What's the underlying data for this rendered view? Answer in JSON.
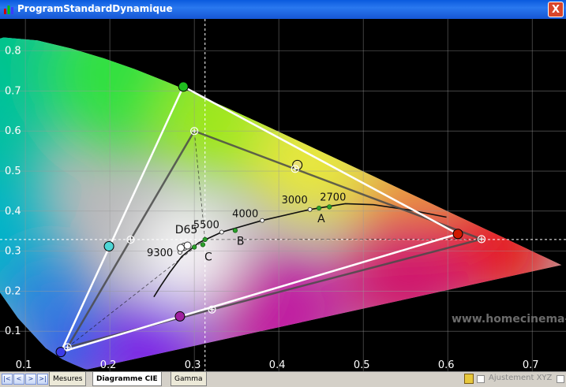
{
  "window": {
    "title": "ProgramStandardDynamique",
    "close_label": "X"
  },
  "tabs": [
    {
      "label": "Mesures",
      "active": false
    },
    {
      "label": "Diagramme CIE",
      "active": true
    },
    {
      "label": "Gamma",
      "active": false
    }
  ],
  "nav": {
    "first": "|<",
    "prev": "<",
    "next": ">",
    "last": ">|"
  },
  "statusbar": {
    "xyz_label": "Ajustement XYZ"
  },
  "watermark": "www.homecinema-",
  "colors": {
    "measured_red": "#d01a00",
    "measured_green": "#1fbe1f",
    "measured_blue": "#3c3ce8",
    "measured_cyan": "#4fd6d6",
    "measured_magenta": "#a020a0",
    "measured_yellow": "#e8e070",
    "gray_point": "#2ca02c",
    "target": "#ffffff"
  },
  "chart_data": {
    "type": "scatter",
    "xlim": [
      0.07,
      0.74
    ],
    "ylim": [
      0.0,
      0.88
    ],
    "xticks": [
      0.1,
      0.2,
      0.3,
      0.4,
      0.5,
      0.6,
      0.7
    ],
    "xtick_labels": [
      "0.1",
      "0.2",
      "0.3",
      "0.4",
      "0.5",
      "0.6",
      "0.7"
    ],
    "yticks": [
      0.1,
      0.2,
      0.3,
      0.4,
      0.5,
      0.6,
      0.7,
      0.8
    ],
    "ytick_labels": [
      "0.1",
      "0.2",
      "0.3",
      "0.4",
      "0.5",
      "0.6",
      "0.7",
      "0.8"
    ],
    "grid": true,
    "spectral_locus": [
      [
        0.1741,
        0.005
      ],
      [
        0.1733,
        0.0048
      ],
      [
        0.1726,
        0.0048
      ],
      [
        0.1714,
        0.0051
      ],
      [
        0.1689,
        0.0069
      ],
      [
        0.1644,
        0.0109
      ],
      [
        0.1566,
        0.0177
      ],
      [
        0.144,
        0.0297
      ],
      [
        0.1241,
        0.0578
      ],
      [
        0.0913,
        0.1327
      ],
      [
        0.0687,
        0.2007
      ],
      [
        0.0454,
        0.295
      ],
      [
        0.0235,
        0.4127
      ],
      [
        0.0082,
        0.5384
      ],
      [
        0.0039,
        0.6548
      ],
      [
        0.0139,
        0.7502
      ],
      [
        0.0389,
        0.812
      ],
      [
        0.0743,
        0.8338
      ],
      [
        0.1142,
        0.8262
      ],
      [
        0.1547,
        0.8059
      ],
      [
        0.1929,
        0.7816
      ],
      [
        0.2296,
        0.7543
      ],
      [
        0.2658,
        0.7243
      ],
      [
        0.3016,
        0.6923
      ],
      [
        0.3373,
        0.6589
      ],
      [
        0.3731,
        0.6245
      ],
      [
        0.4087,
        0.5896
      ],
      [
        0.4441,
        0.5547
      ],
      [
        0.4788,
        0.5202
      ],
      [
        0.5125,
        0.4866
      ],
      [
        0.5448,
        0.4544
      ],
      [
        0.5752,
        0.4242
      ],
      [
        0.6029,
        0.3965
      ],
      [
        0.627,
        0.3725
      ],
      [
        0.6482,
        0.3514
      ],
      [
        0.6658,
        0.334
      ],
      [
        0.6801,
        0.3197
      ],
      [
        0.6915,
        0.3083
      ],
      [
        0.7006,
        0.2993
      ],
      [
        0.7079,
        0.292
      ],
      [
        0.714,
        0.2859
      ],
      [
        0.7347,
        0.2653
      ]
    ],
    "target_gamut": [
      [
        0.64,
        0.33
      ],
      [
        0.3,
        0.6
      ],
      [
        0.15,
        0.06
      ]
    ],
    "target_secondaries": [
      [
        0.2246,
        0.3287
      ],
      [
        0.3209,
        0.1542
      ],
      [
        0.4193,
        0.5053
      ]
    ],
    "measured_gamut": [
      [
        0.612,
        0.343
      ],
      [
        0.287,
        0.711
      ],
      [
        0.142,
        0.048
      ]
    ],
    "measured_secondaries": [
      {
        "name": "cyan",
        "x": 0.199,
        "y": 0.312
      },
      {
        "name": "magenta",
        "x": 0.283,
        "y": 0.137
      },
      {
        "name": "yellow",
        "x": 0.422,
        "y": 0.515
      }
    ],
    "crosshair": {
      "x": 0.3127,
      "y": 0.329
    },
    "blackbody_curve": [
      [
        0.2521,
        0.1856
      ],
      [
        0.2604,
        0.2138
      ],
      [
        0.2712,
        0.2473
      ],
      [
        0.2853,
        0.2869
      ],
      [
        0.3052,
        0.3209
      ],
      [
        0.3324,
        0.3474
      ],
      [
        0.3804,
        0.3767
      ],
      [
        0.4369,
        0.404
      ],
      [
        0.4788,
        0.4185
      ],
      [
        0.5121,
        0.4159
      ],
      [
        0.5554,
        0.4023
      ],
      [
        0.5985,
        0.3849
      ]
    ],
    "cct_labels": [
      {
        "text": "2700",
        "x": 0.4599,
        "y": 0.4106
      },
      {
        "text": "3000",
        "x": 0.4369,
        "y": 0.404
      },
      {
        "text": "4000",
        "x": 0.3804,
        "y": 0.3767
      },
      {
        "text": "5500",
        "x": 0.3324,
        "y": 0.3474
      },
      {
        "text": "9300",
        "x": 0.2831,
        "y": 0.2971
      }
    ],
    "illuminants": [
      {
        "label": "A",
        "x": 0.4476,
        "y": 0.4074
      },
      {
        "label": "B",
        "x": 0.3484,
        "y": 0.3516
      },
      {
        "label": "C",
        "x": 0.3101,
        "y": 0.3162
      },
      {
        "label": "D65",
        "x": 0.3127,
        "y": 0.329
      }
    ],
    "grayscale_points": [
      [
        0.4599,
        0.4106
      ],
      [
        0.4476,
        0.4074
      ],
      [
        0.3484,
        0.3516
      ],
      [
        0.3127,
        0.329
      ],
      [
        0.3101,
        0.3162
      ],
      [
        0.3,
        0.31
      ]
    ],
    "white_points": [
      [
        0.288,
        0.311
      ],
      [
        0.292,
        0.314
      ],
      [
        0.284,
        0.308
      ]
    ]
  }
}
